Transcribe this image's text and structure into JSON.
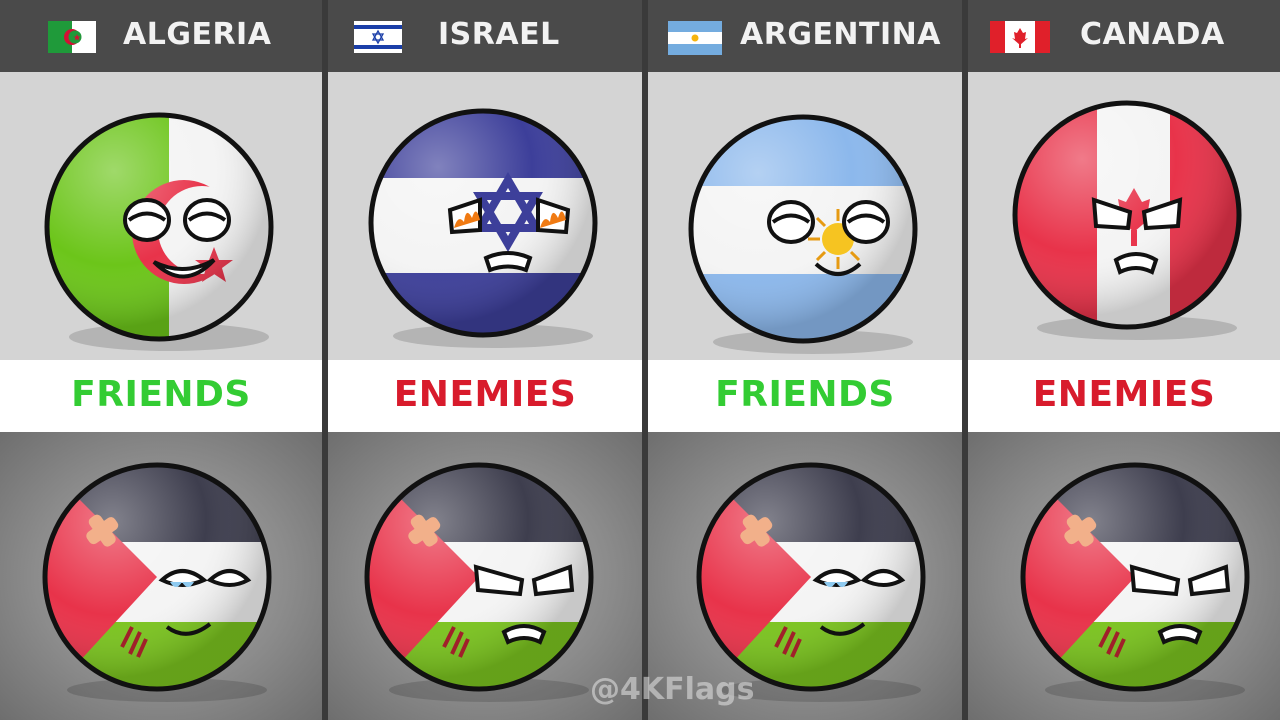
{
  "columns": [
    {
      "country": "ALGERIA",
      "relation": "FRIENDS",
      "relation_color": "#33cc33",
      "flag_icon": "algeria-flag-icon",
      "reaction": "happy"
    },
    {
      "country": "ISRAEL",
      "relation": "ENEMIES",
      "relation_color": "#d81b2c",
      "flag_icon": "israel-flag-icon",
      "reaction": "angry"
    },
    {
      "country": "ARGENTINA",
      "relation": "FRIENDS",
      "relation_color": "#33cc33",
      "flag_icon": "argentina-flag-icon",
      "reaction": "happy"
    },
    {
      "country": "CANADA",
      "relation": "ENEMIES",
      "relation_color": "#d81b2c",
      "flag_icon": "canada-flag-icon",
      "reaction": "angry"
    }
  ],
  "watermark": "@4KFlags",
  "colors": {
    "header_bg": "#4a4a4a",
    "top_panel_bg": "#d4d4d4",
    "label_band_bg": "#ffffff",
    "friends": "#33cc33",
    "enemies": "#d81b2c"
  }
}
